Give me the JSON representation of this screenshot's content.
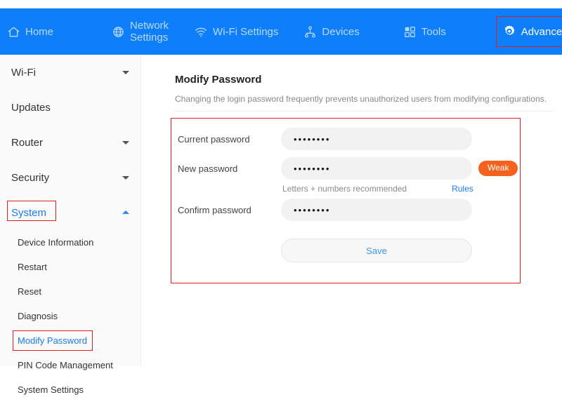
{
  "theme": {
    "nav_blue": "#0f7efa",
    "link_blue": "#1a7cf5",
    "badge_orange": "#f4621e",
    "highlight_red": "#e02020"
  },
  "topnav": {
    "items": [
      {
        "label": "Home",
        "icon": "home-icon",
        "active": false
      },
      {
        "label": "Network Settings",
        "icon": "globe-icon",
        "active": false
      },
      {
        "label": "Wi-Fi Settings",
        "icon": "wifi-icon",
        "active": false
      },
      {
        "label": "Devices",
        "icon": "devices-sitemap-icon",
        "active": false
      },
      {
        "label": "Tools",
        "icon": "tools-grid-icon",
        "active": false
      },
      {
        "label": "Advanced",
        "icon": "gear-icon",
        "active": true
      }
    ]
  },
  "sidebar": {
    "groups": [
      {
        "label": "Wi-Fi",
        "caret": "down",
        "selected": false
      },
      {
        "label": "Updates",
        "caret": "none",
        "selected": false
      },
      {
        "label": "Router",
        "caret": "down",
        "selected": false
      },
      {
        "label": "Security",
        "caret": "down",
        "selected": false
      },
      {
        "label": "System",
        "caret": "up",
        "selected": true
      }
    ],
    "subitems": [
      {
        "label": "Device Information",
        "selected": false
      },
      {
        "label": "Restart",
        "selected": false
      },
      {
        "label": "Reset",
        "selected": false
      },
      {
        "label": "Diagnosis",
        "selected": false
      },
      {
        "label": "Modify Password",
        "selected": true
      },
      {
        "label": "PIN Code Management",
        "selected": false
      },
      {
        "label": "System Settings",
        "selected": false
      }
    ]
  },
  "main": {
    "title": "Modify Password",
    "description": "Changing the login password frequently prevents unauthorized users from modifying configurations.",
    "fields": {
      "current": {
        "label": "Current password",
        "value": "••••••••",
        "placeholder": ""
      },
      "new": {
        "label": "New password",
        "value": "••••••••",
        "placeholder": ""
      },
      "confirm": {
        "label": "Confirm password",
        "value": "••••••••",
        "placeholder": ""
      }
    },
    "strength_badge": "Weak",
    "hint_text": "Letters + numbers recommended",
    "rules_link": "Rules",
    "save_label": "Save"
  }
}
